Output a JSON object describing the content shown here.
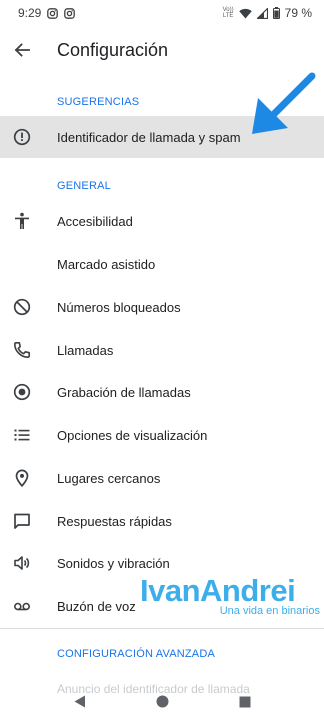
{
  "status": {
    "time": "9:29",
    "network_top": "Vo))",
    "network_bottom": "LTE",
    "battery": "79 %"
  },
  "header": {
    "title": "Configuración"
  },
  "sections": {
    "suggestions": "SUGERENCIAS",
    "general": "GENERAL",
    "advanced": "CONFIGURACIÓN AVANZADA"
  },
  "items": {
    "caller_id": "Identificador de llamada y spam",
    "accessibility": "Accesibilidad",
    "assisted_dialing": "Marcado asistido",
    "blocked_numbers": "Números bloqueados",
    "calls": "Llamadas",
    "call_recording": "Grabación de llamadas",
    "display_options": "Opciones de visualización",
    "nearby_places": "Lugares cercanos",
    "quick_responses": "Respuestas rápidas",
    "sounds_vibration": "Sonidos y vibración",
    "voicemail": "Buzón de voz",
    "caller_id_announcement": "Anuncio del identificador de llamada"
  },
  "watermark": {
    "name": "IvanAndrei",
    "tagline": "Una vida en binarios"
  },
  "colors": {
    "accent": "#1a73e8",
    "highlight": "#e3e3e3",
    "arrow": "#1e88e5",
    "watermark": "#3daee9"
  },
  "icons": {
    "back": "arrow-back-icon",
    "caller_id": "alert-circle-icon",
    "accessibility": "accessibility-icon",
    "blocked_numbers": "block-icon",
    "calls": "phone-icon",
    "call_recording": "record-icon",
    "display_options": "list-icon",
    "nearby_places": "location-pin-icon",
    "quick_responses": "chat-bubble-icon",
    "sounds_vibration": "volume-icon",
    "voicemail": "voicemail-icon"
  }
}
